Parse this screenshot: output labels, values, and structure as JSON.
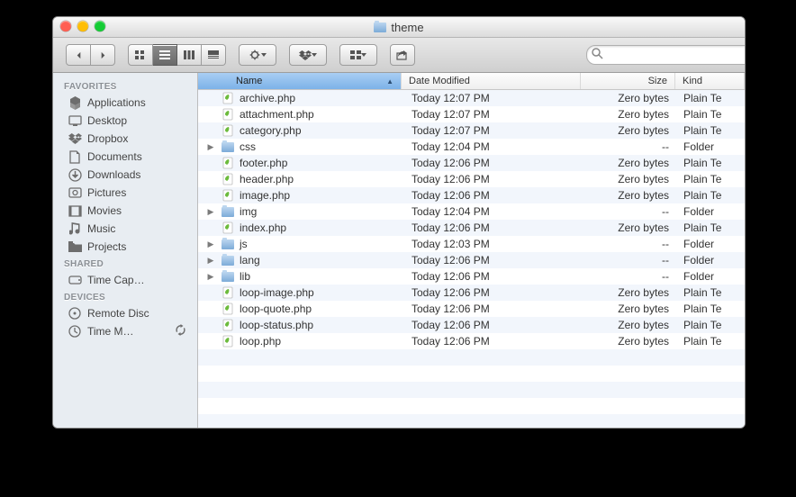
{
  "window": {
    "title": "theme"
  },
  "traffic": {
    "close": "#ff5f52",
    "min": "#ffbe05",
    "zoom": "#15cc35"
  },
  "search": {
    "placeholder": ""
  },
  "sidebar": {
    "sections": [
      {
        "label": "FAVORITES",
        "items": [
          {
            "icon": "apps",
            "label": "Applications"
          },
          {
            "icon": "desk",
            "label": "Desktop"
          },
          {
            "icon": "dbox",
            "label": "Dropbox"
          },
          {
            "icon": "docs",
            "label": "Documents"
          },
          {
            "icon": "down",
            "label": "Downloads"
          },
          {
            "icon": "pics",
            "label": "Pictures"
          },
          {
            "icon": "mov",
            "label": "Movies"
          },
          {
            "icon": "mus",
            "label": "Music"
          },
          {
            "icon": "proj",
            "label": "Projects"
          }
        ]
      },
      {
        "label": "SHARED",
        "items": [
          {
            "icon": "disk",
            "label": "Time Cap…"
          }
        ]
      },
      {
        "label": "DEVICES",
        "items": [
          {
            "icon": "rdisc",
            "label": "Remote Disc"
          },
          {
            "icon": "tm",
            "label": "Time M…",
            "sync": true
          }
        ]
      }
    ]
  },
  "columns": {
    "name": "Name",
    "date": "Date Modified",
    "size": "Size",
    "kind": "Kind"
  },
  "files": [
    {
      "kind": "file",
      "name": "archive.php",
      "date": "Today 12:07 PM",
      "size": "Zero bytes",
      "k": "Plain Te"
    },
    {
      "kind": "file",
      "name": "attachment.php",
      "date": "Today 12:07 PM",
      "size": "Zero bytes",
      "k": "Plain Te"
    },
    {
      "kind": "file",
      "name": "category.php",
      "date": "Today 12:07 PM",
      "size": "Zero bytes",
      "k": "Plain Te"
    },
    {
      "kind": "folder",
      "name": "css",
      "date": "Today 12:04 PM",
      "size": "--",
      "k": "Folder",
      "disclose": true
    },
    {
      "kind": "file",
      "name": "footer.php",
      "date": "Today 12:06 PM",
      "size": "Zero bytes",
      "k": "Plain Te"
    },
    {
      "kind": "file",
      "name": "header.php",
      "date": "Today 12:06 PM",
      "size": "Zero bytes",
      "k": "Plain Te"
    },
    {
      "kind": "file",
      "name": "image.php",
      "date": "Today 12:06 PM",
      "size": "Zero bytes",
      "k": "Plain Te"
    },
    {
      "kind": "folder",
      "name": "img",
      "date": "Today 12:04 PM",
      "size": "--",
      "k": "Folder",
      "disclose": true
    },
    {
      "kind": "file",
      "name": "index.php",
      "date": "Today 12:06 PM",
      "size": "Zero bytes",
      "k": "Plain Te"
    },
    {
      "kind": "folder",
      "name": "js",
      "date": "Today 12:03 PM",
      "size": "--",
      "k": "Folder",
      "disclose": true
    },
    {
      "kind": "folder",
      "name": "lang",
      "date": "Today 12:06 PM",
      "size": "--",
      "k": "Folder",
      "disclose": true
    },
    {
      "kind": "folder",
      "name": "lib",
      "date": "Today 12:06 PM",
      "size": "--",
      "k": "Folder",
      "disclose": true
    },
    {
      "kind": "file",
      "name": "loop-image.php",
      "date": "Today 12:06 PM",
      "size": "Zero bytes",
      "k": "Plain Te"
    },
    {
      "kind": "file",
      "name": "loop-quote.php",
      "date": "Today 12:06 PM",
      "size": "Zero bytes",
      "k": "Plain Te"
    },
    {
      "kind": "file",
      "name": "loop-status.php",
      "date": "Today 12:06 PM",
      "size": "Zero bytes",
      "k": "Plain Te"
    },
    {
      "kind": "file",
      "name": "loop.php",
      "date": "Today 12:06 PM",
      "size": "Zero bytes",
      "k": "Plain Te"
    }
  ]
}
